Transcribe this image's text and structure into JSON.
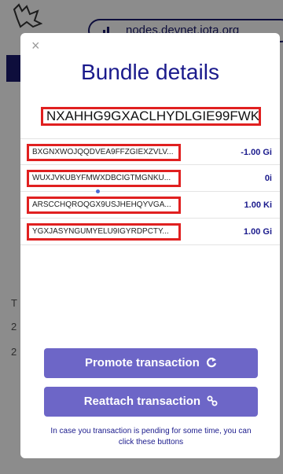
{
  "background": {
    "node_selector": "nodes.devnet.iota.org",
    "row_labels": [
      "T",
      "2",
      "2"
    ]
  },
  "modal": {
    "close_icon": "×",
    "title": "Bundle details",
    "bundle_hash": "NXAHHG9GXACLHYDLGIE99FWK...",
    "transactions": [
      {
        "hash": "BXGNXWOJQQDVEA9FFZGIEXZVLV...",
        "value": "-1.00 Gi"
      },
      {
        "hash": "WUXJVKUBYFMWXDBCIGTMGNKU...",
        "value": "0i"
      },
      {
        "hash": "ARSCCHQROQGX9USJHEHQYVGA...",
        "value": "1.00 Ki"
      },
      {
        "hash": "YGXJASYNGUMYELU9IGYRDPCTY...",
        "value": "1.00 Gi"
      }
    ],
    "promote_label": "Promote transaction",
    "promote_icon": "C",
    "reattach_label": "Reattach transaction",
    "reattach_icon": "%",
    "hint": "In case you transaction is pending for some time, you can click these buttons"
  },
  "colors": {
    "accent": "#6d66c7",
    "title": "#1a1a8c",
    "highlight_border": "#e02020"
  },
  "icons": {
    "close": "close-icon",
    "promote": "refresh-icon",
    "reattach": "link-icon",
    "signal": "signal-icon"
  }
}
